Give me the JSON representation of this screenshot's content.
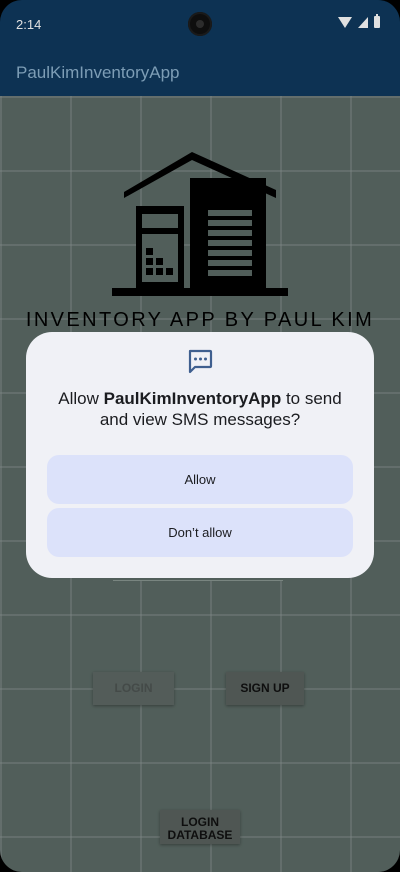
{
  "status_bar": {
    "time": "2:14"
  },
  "app_bar": {
    "title": "PaulKimInventoryApp"
  },
  "logo": {
    "text": "INVENTORY APP BY PAUL KIM"
  },
  "buttons": {
    "login": "LOGIN",
    "signup": "SIGN UP",
    "login_database": "LOGIN DATABASE"
  },
  "dialog": {
    "prefix": "Allow ",
    "app_name": "PaulKimInventoryApp",
    "suffix": " to send and view SMS messages?",
    "allow": "Allow",
    "deny": "Don’t allow"
  },
  "colors": {
    "app_bar": "#0f3a5f",
    "background": "#5d6c67",
    "dialog": "#f0f1f6",
    "dialog_button": "#dce2fa",
    "icon_accent": "#3f5f8f"
  }
}
